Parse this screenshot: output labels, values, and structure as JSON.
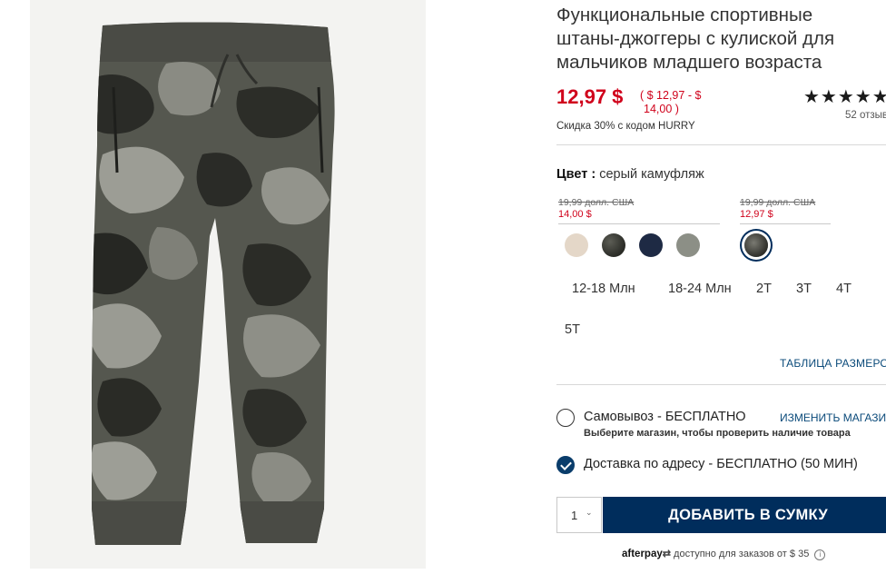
{
  "product": {
    "title_line1": "Функциональные спортивные",
    "title_line2": "штаны-джоггеры с кулиской для",
    "title_line3": "мальчиков младшего возраста",
    "price": "12,97 $",
    "price_range_line1": "( $ 12,97 - $",
    "price_range_line2": "14,00 )",
    "promo": "Скидка 30% с кодом HURRY",
    "stars": "★★★★★",
    "reviews": "52 отзыв"
  },
  "color": {
    "label": "Цвет :",
    "value": "серый камуфляж",
    "groups": [
      {
        "old_price": "19,99 долл. США",
        "new_price": "14,00 $"
      },
      {
        "old_price": "19,99 долл. США",
        "new_price": "12,97 $"
      }
    ],
    "swatches": [
      {
        "name": "cream",
        "color": "#e4d7c8"
      },
      {
        "name": "olive camo",
        "color": "#3a3a33"
      },
      {
        "name": "navy",
        "color": "#1e2a44"
      },
      {
        "name": "heather gray",
        "color": "#8c8f86"
      },
      {
        "name": "gray camo",
        "color": "#4b4a44",
        "selected": true
      }
    ]
  },
  "sizes": [
    "12-18 Млн",
    "18-24 Млн",
    "2T",
    "3T",
    "4T",
    "5T"
  ],
  "size_chart_link": "ТАБЛИЦА РАЗМЕРОВ",
  "fulfillment": {
    "pickup_label": "Самовывоз - БЕСПЛАТНО",
    "change_store": "ИЗМЕНИТЬ МАГАЗИН",
    "pickup_note": "Выберите магазин, чтобы проверить наличие товара",
    "delivery_label": "Доставка по адресу - БЕСПЛАТНО (50 МИН)"
  },
  "cart": {
    "quantity": "1",
    "add_button": "ДОБАВИТЬ В СУМКУ"
  },
  "afterpay": {
    "logo": "afterpay",
    "text": "доступно для заказов от $ 35"
  },
  "colors": {
    "price_red": "#d0021b",
    "brand_navy": "#002d5c",
    "link_blue": "#0a4a7a"
  }
}
